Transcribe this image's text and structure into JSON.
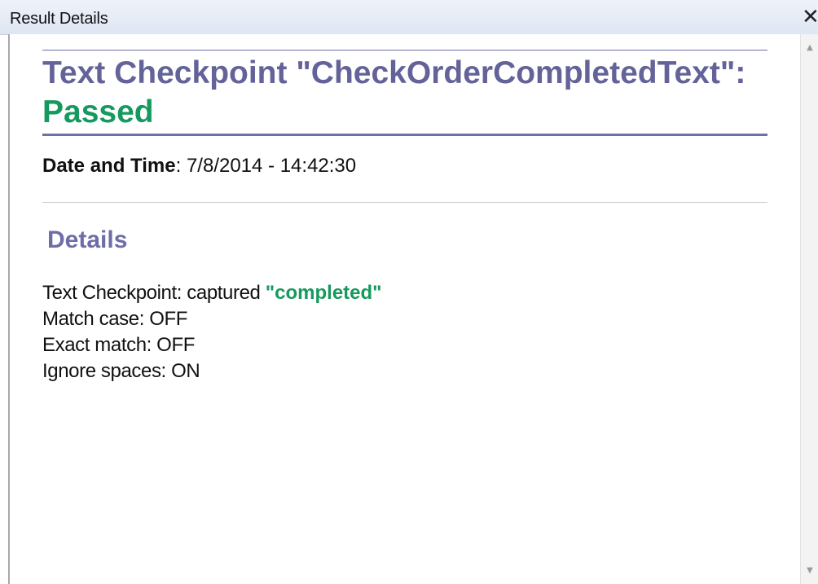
{
  "window": {
    "title": "Result Details",
    "close_glyph": "✕"
  },
  "heading": {
    "prefix": "Text Checkpoint \"CheckOrderCompletedText\": ",
    "status": "Passed"
  },
  "date_time": {
    "label": "Date and Time",
    "separator": ": ",
    "value": "7/8/2014 - 14:42:30"
  },
  "details": {
    "heading": "Details",
    "captured_prefix": "Text Checkpoint: captured ",
    "captured_value": "\"completed\"",
    "match_case": "Match case: OFF",
    "exact_match": "Exact match: OFF",
    "ignore_spaces": "Ignore spaces: ON"
  },
  "colors": {
    "heading": "#63639a",
    "status_passed": "#16995e",
    "details_heading": "#6d6da8"
  },
  "icons": {
    "close": "close-icon",
    "scroll_up": "scroll-up-arrow-icon",
    "scroll_down": "scroll-down-arrow-icon"
  }
}
